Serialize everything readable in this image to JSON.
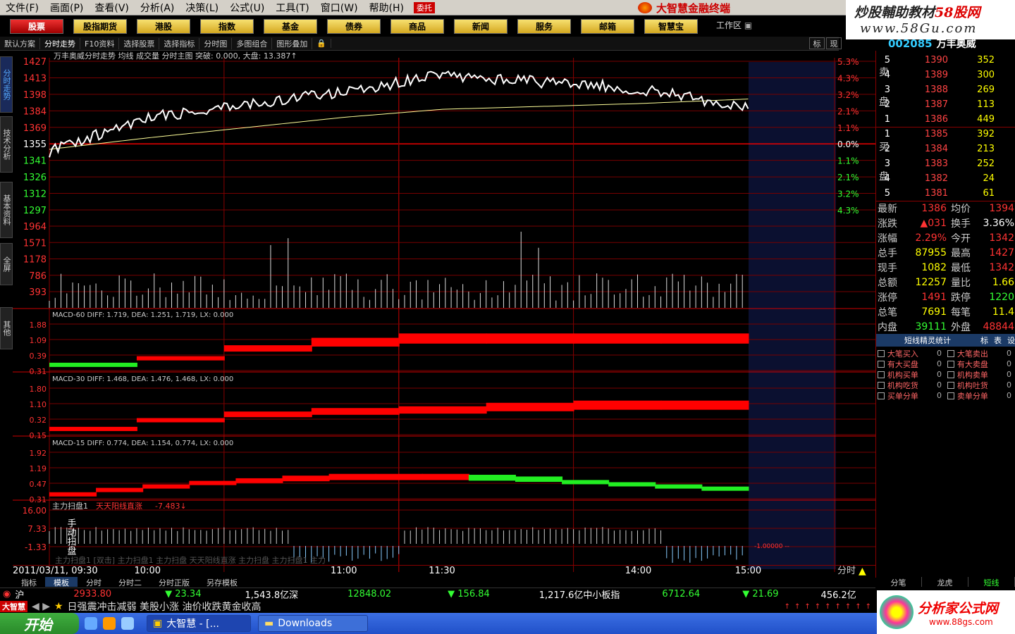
{
  "menu": [
    "文件(F)",
    "画面(P)",
    "查看(V)",
    "分析(A)",
    "决策(L)",
    "公式(U)",
    "工具(T)",
    "窗口(W)",
    "帮助(H)"
  ],
  "menu_tag": "委托",
  "brand": "大智慧金融终端",
  "watermark_top": {
    "line1a": "炒股輔助教材",
    "line1b": "58股网",
    "line2": "www.58Gu.com"
  },
  "nav": [
    "股票",
    "股指期货",
    "港股",
    "指数",
    "基金",
    "债券",
    "商品",
    "新闻",
    "服务",
    "邮箱",
    "智慧宝"
  ],
  "workarea": "工作区",
  "toolbar": [
    "默认方案",
    "分时走势",
    "F10资料",
    "选择股票",
    "选择指标",
    "分时图",
    "多图组合",
    "图形叠加"
  ],
  "right_tabs": [
    "标",
    "现"
  ],
  "stock": {
    "code": "002085",
    "name": "万丰奥威"
  },
  "vtabs": [
    "分时走势",
    "技术分析",
    "基本资料",
    "全屏",
    "其他"
  ],
  "chart": {
    "header": "万丰奥威分时走势  均线  成交量  分时主图  突破: 0.000, 大盘: 13.387↑",
    "price_ticks": [
      "1427",
      "1413",
      "1398",
      "1384",
      "1369",
      "1355",
      "1341",
      "1326",
      "1312",
      "1297"
    ],
    "pct_ticks": [
      "5.3%",
      "4.3%",
      "3.2%",
      "2.1%",
      "1.1%",
      "0.0%",
      "1.1%",
      "2.1%",
      "3.2%",
      "4.3%"
    ],
    "vol_ticks": [
      "1964",
      "1571",
      "1178",
      "786",
      "393"
    ],
    "macd60": {
      "label": "MACD-60",
      "diff": "1.719",
      "dea": "1.251",
      "m": "1.719",
      "lx": "0.000",
      "ticks": [
        "1.88",
        "1.09",
        "0.39",
        "0.31"
      ]
    },
    "macd30": {
      "label": "MACD-30",
      "diff": "1.468",
      "dea": "1.476",
      "m": "1.468",
      "lx": "0.000",
      "ticks": [
        "1.80",
        "1.10",
        "0.32",
        "0.15"
      ]
    },
    "macd15": {
      "label": "MACD-15",
      "diff": "0.774",
      "dea": "1.154",
      "m": "0.774",
      "lx": "0.000",
      "ticks": [
        "1.92",
        "1.19",
        "0.47",
        "0.31"
      ]
    },
    "scan": {
      "label": "主力扫盘1",
      "sub": "天天阳线直涨",
      "val": "-7.483↓",
      "ticks": [
        "16.00",
        "7.33",
        "-1.33"
      ],
      "vlabel": "手动扫盘",
      "note": "-1.00000 --",
      "faded": "主力扫盘1 [双击] 主力扫盘1 主力扫盘 天天阳线直涨 主力扫盘 主力扫盘1 主力"
    },
    "time_ticks": [
      "2011/03/11, 09:30",
      "10:00",
      "11:00",
      "11:30",
      "14:00",
      "15:00"
    ],
    "period": "分时"
  },
  "chart_data": {
    "type": "line",
    "title": "万丰奥威分时走势",
    "x": [
      "09:30",
      "10:00",
      "11:00",
      "11:30",
      "14:00",
      "15:00"
    ],
    "price": [
      1348,
      1378,
      1400,
      1415,
      1403,
      1386
    ],
    "avg": [
      1350,
      1360,
      1378,
      1385,
      1390,
      1394
    ],
    "ylim": [
      1297,
      1427
    ],
    "prev_close": 1355
  },
  "orderbook": {
    "sell": [
      {
        "i": "5",
        "p": "1390",
        "v": "352"
      },
      {
        "i": "4",
        "p": "1389",
        "v": "300"
      },
      {
        "i": "3",
        "p": "1388",
        "v": "269"
      },
      {
        "i": "2",
        "p": "1387",
        "v": "113"
      },
      {
        "i": "1",
        "p": "1386",
        "v": "449"
      }
    ],
    "buy": [
      {
        "i": "1",
        "p": "1385",
        "v": "392"
      },
      {
        "i": "2",
        "p": "1384",
        "v": "213"
      },
      {
        "i": "3",
        "p": "1383",
        "v": "252"
      },
      {
        "i": "4",
        "p": "1382",
        "v": "24"
      },
      {
        "i": "5",
        "p": "1381",
        "v": "61"
      }
    ],
    "sell_label": [
      "卖",
      "盘"
    ],
    "buy_label": [
      "买",
      "盘"
    ]
  },
  "stats": [
    {
      "k": "最新",
      "v": "1386",
      "c": "red",
      "k2": "均价",
      "v2": "1394",
      "c2": "red"
    },
    {
      "k": "涨跌",
      "v": "▲031",
      "c": "red",
      "k2": "换手",
      "v2": "3.36%",
      "c2": "white"
    },
    {
      "k": "涨幅",
      "v": "2.29%",
      "c": "red",
      "k2": "今开",
      "v2": "1342",
      "c2": "red"
    },
    {
      "k": "总手",
      "v": "87955",
      "c": "yellow",
      "k2": "最高",
      "v2": "1427",
      "c2": "red"
    },
    {
      "k": "现手",
      "v": "1082",
      "c": "yellow",
      "k2": "最低",
      "v2": "1342",
      "c2": "red"
    },
    {
      "k": "总额",
      "v": "12257",
      "c": "yellow",
      "k2": "量比",
      "v2": "1.66",
      "c2": "yellow"
    },
    {
      "k": "涨停",
      "v": "1491",
      "c": "red",
      "k2": "跌停",
      "v2": "1220",
      "c2": "green"
    },
    {
      "k": "总笔",
      "v": "7691",
      "c": "yellow",
      "k2": "每笔",
      "v2": "11.4",
      "c2": "yellow"
    },
    {
      "k": "内盘",
      "v": "39111",
      "c": "green",
      "k2": "外盘",
      "v2": "48844",
      "c2": "red"
    }
  ],
  "duanxian": {
    "title": "短线精灵统计",
    "tabs": [
      "标",
      "表",
      "设"
    ]
  },
  "signals": [
    {
      "a": "大笔买入",
      "an": "0",
      "b": "大笔卖出",
      "bn": "0"
    },
    {
      "a": "有大买盘",
      "an": "0",
      "b": "有大卖盘",
      "bn": "0"
    },
    {
      "a": "机构买单",
      "an": "0",
      "b": "机构卖单",
      "bn": "0"
    },
    {
      "a": "机构吃货",
      "an": "0",
      "b": "机构吐货",
      "bn": "0"
    },
    {
      "a": "买单分单",
      "an": "0",
      "b": "卖单分单",
      "bn": "0"
    }
  ],
  "bottom_tabs": [
    "指标",
    "模板",
    "分时",
    "分时二",
    "分时正版",
    "另存模板"
  ],
  "right_bottom_tabs": [
    "分笔",
    "龙虎",
    "短线"
  ],
  "indices": {
    "sh": "沪",
    "sh_v": "2933.80",
    "sh_c": "▼ 23.34",
    "sh_a": "1,543.8亿",
    "sz": "深",
    "sz_v": "12848.02",
    "sz_c": "▼ 156.84",
    "sz_a": "1,217.6亿",
    "zx": "中小板指",
    "zx_v": "6712.64",
    "zx_c": "▼ 21.69",
    "zx_a": "456.2亿"
  },
  "news": {
    "logo": "大智慧",
    "text": "日强震冲击减弱 美股小涨 油价收跌黄金收高"
  },
  "taskbar": {
    "start": "开始",
    "tasks": [
      "大智慧 - [...",
      "Downloads"
    ]
  },
  "watermark_bottom": {
    "t1": "分析家公式网",
    "t2": "www.88gs.com"
  }
}
